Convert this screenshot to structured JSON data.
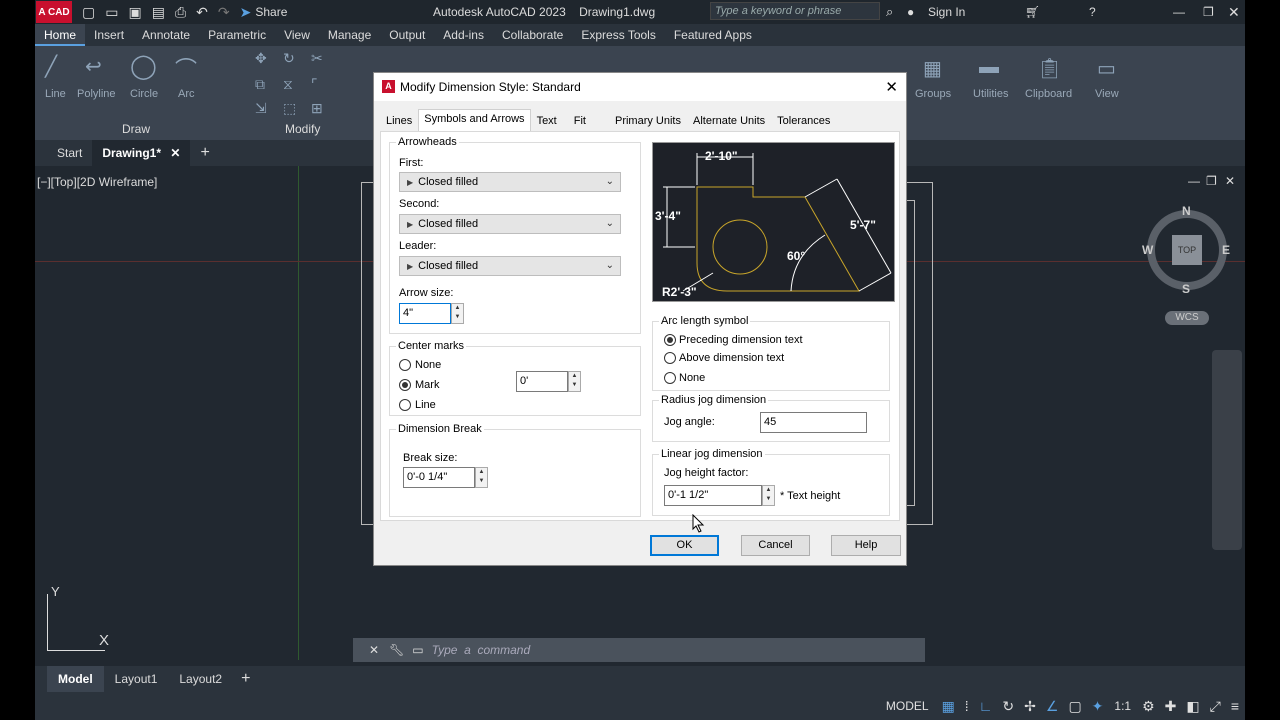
{
  "app": {
    "logo_text": "A CAD",
    "title": "Autodesk AutoCAD 2023    Drawing1.dwg",
    "share_label": "Share",
    "search_placeholder": "Type a keyword or phrase",
    "sign_in": "Sign In"
  },
  "ribbon": {
    "tabs": [
      "Home",
      "Insert",
      "Annotate",
      "Parametric",
      "View",
      "Manage",
      "Output",
      "Add-ins",
      "Collaborate",
      "Express Tools",
      "Featured Apps"
    ],
    "active_tab": "Home",
    "tools": [
      "Line",
      "Polyline",
      "Circle",
      "Arc"
    ],
    "panels": {
      "draw": "Draw",
      "modify": "Modify",
      "groups": "Groups",
      "utilities": "Utilities",
      "clipboard": "Clipboard",
      "view": "View"
    }
  },
  "file_tabs": {
    "start": "Start",
    "drawing": "Drawing1*"
  },
  "viewport": {
    "label": "[−][Top][2D Wireframe]",
    "compass": {
      "n": "N",
      "s": "S",
      "e": "E",
      "w": "W",
      "top": "TOP",
      "wcs": "WCS"
    },
    "ucs": {
      "y": "Y",
      "x": "X"
    }
  },
  "dialog": {
    "title": "Modify Dimension Style: Standard",
    "tabs": [
      "Lines",
      "Symbols and Arrows",
      "Text",
      "Fit",
      "Primary Units",
      "Alternate Units",
      "Tolerances"
    ],
    "active_tab": "Symbols and Arrows",
    "arrowheads": {
      "title": "Arrowheads",
      "first_label": "First:",
      "first_value": "Closed filled",
      "second_label": "Second:",
      "second_value": "Closed filled",
      "leader_label": "Leader:",
      "leader_value": "Closed filled",
      "arrow_size_label": "Arrow size:",
      "arrow_size_value": "4\""
    },
    "center_marks": {
      "title": "Center marks",
      "options": [
        "None",
        "Mark",
        "Line"
      ],
      "selected": "Mark",
      "size_value": "0'"
    },
    "dimension_break": {
      "title": "Dimension Break",
      "break_size_label": "Break size:",
      "break_size_value": "0'-0 1/4\""
    },
    "preview": {
      "dim_top": "2'-10\"",
      "dim_left": "3'-4\"",
      "dim_right": "5'-7\"",
      "dim_angle": "60°",
      "dim_radius": "R2'-3\""
    },
    "arc_length": {
      "title": "Arc length symbol",
      "options": [
        "Preceding dimension text",
        "Above dimension text",
        "None"
      ],
      "selected": "Preceding dimension text"
    },
    "radius_jog": {
      "title": "Radius jog dimension",
      "jog_angle_label": "Jog angle:",
      "jog_angle_value": "45"
    },
    "linear_jog": {
      "title": "Linear jog dimension",
      "height_label": "Jog height factor:",
      "height_value": "0'-1 1/2\"",
      "suffix": "* Text height"
    },
    "buttons": {
      "ok": "OK",
      "cancel": "Cancel",
      "help": "Help"
    }
  },
  "command_line": {
    "placeholder": "Type  a  command"
  },
  "layout_tabs": [
    "Model",
    "Layout1",
    "Layout2"
  ],
  "status_bar": {
    "model": "MODEL",
    "scale": "1:1"
  },
  "colors": {
    "accent": "#0078d7",
    "autocad_red": "#c8102e",
    "preview_bg": "#1e2128",
    "preview_geometry": "#c8a52a"
  }
}
